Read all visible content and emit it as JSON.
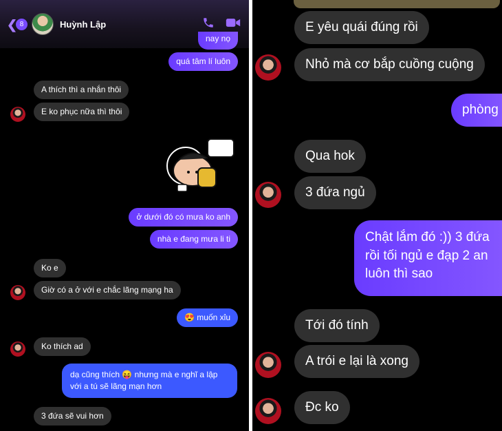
{
  "left": {
    "header": {
      "back_icon": "chevron-left-icon",
      "badge": "8",
      "contact_name": "Huỳnh Lập",
      "call_icon": "phone-icon",
      "video_icon": "video-camera-icon"
    },
    "messages": [
      {
        "side": "out",
        "text": "nay nọ"
      },
      {
        "side": "out",
        "text": "quá tâm lí luôn"
      },
      {
        "side": "in",
        "text": "A thích thì a nhắn thôi"
      },
      {
        "side": "in",
        "text": "E ko phục nữa thì thôi"
      },
      {
        "side": "out",
        "text": "ở dưới đó có mưa ko anh"
      },
      {
        "side": "out",
        "text": "nhà e đang mưa li ti"
      },
      {
        "side": "in",
        "text": "Ko e"
      },
      {
        "side": "in",
        "text": "Giờ có a ở với e chắc lãng mạng ha"
      },
      {
        "side": "out",
        "text": "😍 muốn xỉu"
      },
      {
        "side": "in",
        "text": "Ko thích ad"
      },
      {
        "side": "out",
        "text": "dạ cũng thích 😝 nhưng mà e nghĩ a lập với a tú sẽ lãng mạn hơn"
      },
      {
        "side": "in",
        "text": "3 đứa sẽ vui hơn"
      }
    ],
    "sticker": "sticker-image"
  },
  "right": {
    "messages": [
      {
        "side": "in",
        "text": "E yêu quái đúng rồi"
      },
      {
        "side": "in",
        "text": "Nhỏ mà cơ bắp cuồng cuộng"
      },
      {
        "side": "out",
        "text": "phòng"
      },
      {
        "side": "in",
        "text": "Qua hok"
      },
      {
        "side": "in",
        "text": "3 đứa ngủ"
      },
      {
        "side": "out",
        "text": "Chật lắm đó :)) 3 đứa rồi tối ngủ e đạp 2 an luôn thì sao"
      },
      {
        "side": "in",
        "text": "Tới đó tính"
      },
      {
        "side": "in",
        "text": "A trói e lại là xong"
      },
      {
        "side": "in",
        "text": "Đc ko"
      }
    ]
  },
  "colors": {
    "incoming_bubble": "#303030",
    "outgoing_bubble": "#7a4cff",
    "outgoing_blue": "#3c59ff",
    "background": "#000000"
  }
}
